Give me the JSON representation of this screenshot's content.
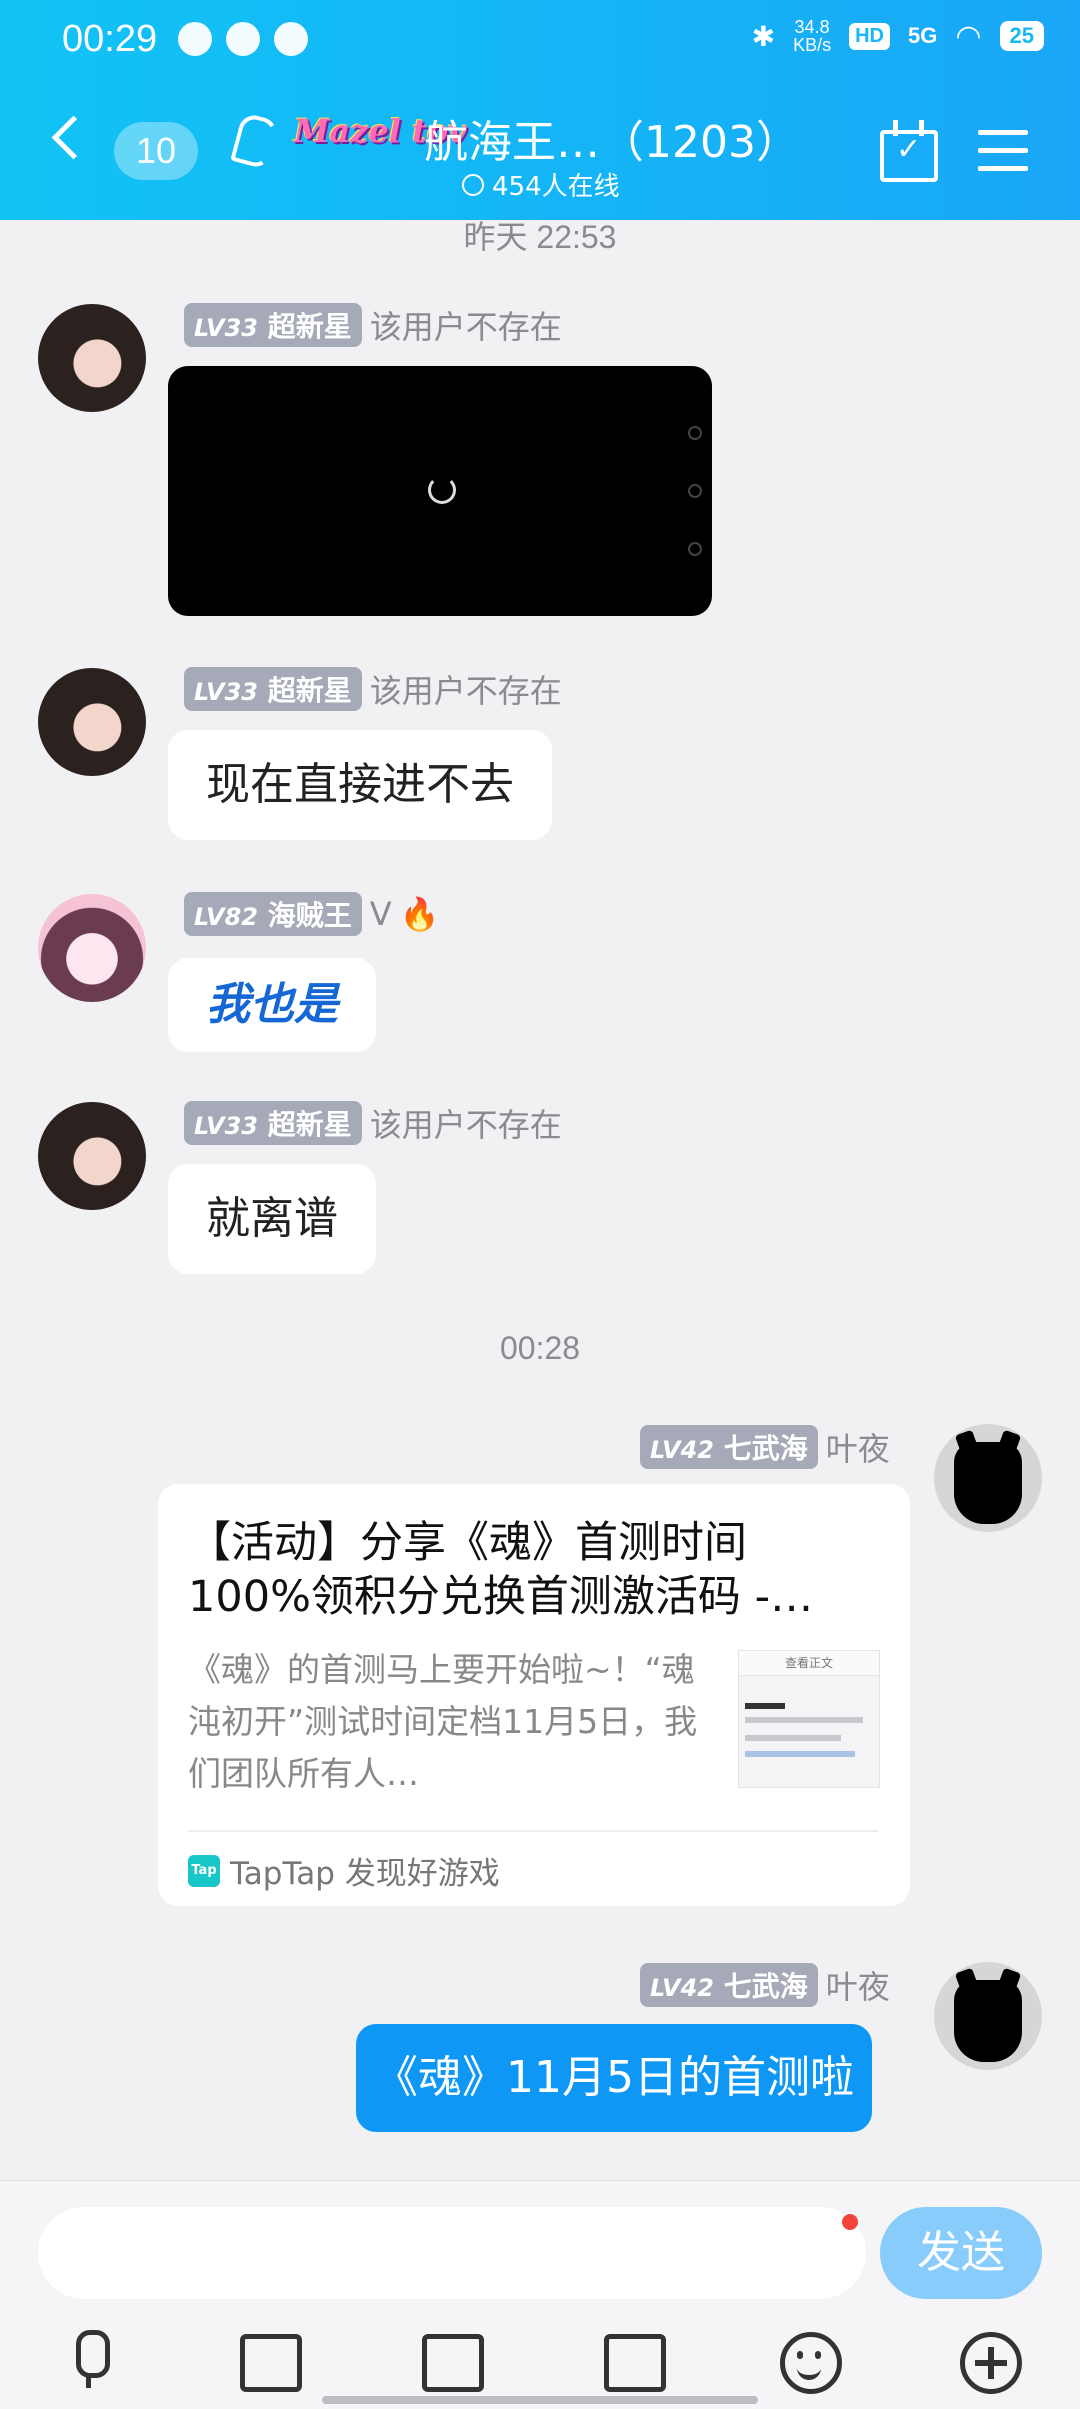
{
  "status_bar": {
    "time": "00:29",
    "net_speed_value": "34.8",
    "net_speed_unit": "KB/s",
    "hd_label": "HD",
    "signal": "5G",
    "battery": "25"
  },
  "header": {
    "unread_count": "10",
    "logo_text": "Mazel tov",
    "title": "航海王…（1203）",
    "online_text": "454人在线",
    "accent": "#14b4f6"
  },
  "messages": {
    "ts_yesterday": "昨天 22:53",
    "m1": {
      "level": "LV33",
      "title": "超新星",
      "name": "该用户不存在"
    },
    "m2": {
      "level": "LV33",
      "title": "超新星",
      "name": "该用户不存在",
      "text": "现在直接进不去"
    },
    "m3": {
      "level": "LV82",
      "title": "海贼王",
      "name": "V",
      "text": "我也是"
    },
    "m4": {
      "level": "LV33",
      "title": "超新星",
      "name": "该用户不存在",
      "text": "就离谱"
    },
    "ts_now": "00:28",
    "m5": {
      "level": "LV42",
      "title": "七武海",
      "name": "叶夜",
      "card_title": "【活动】分享《魂》首测时间100%领积分兑换首测激活码 -…",
      "card_desc": "《魂》的首测马上要开始啦~！“魂沌初开”测试时间定档11月5日，我们团队所有人…",
      "card_thumb_header": "查看正文",
      "card_source": "TapTap 发现好游戏",
      "tap_logo": "Tap"
    },
    "m6": {
      "level": "LV42",
      "title": "七武海",
      "name": "叶夜",
      "text": "《魂》11月5日的首测啦"
    }
  },
  "composer": {
    "input_value": "",
    "send_label": "发送"
  }
}
